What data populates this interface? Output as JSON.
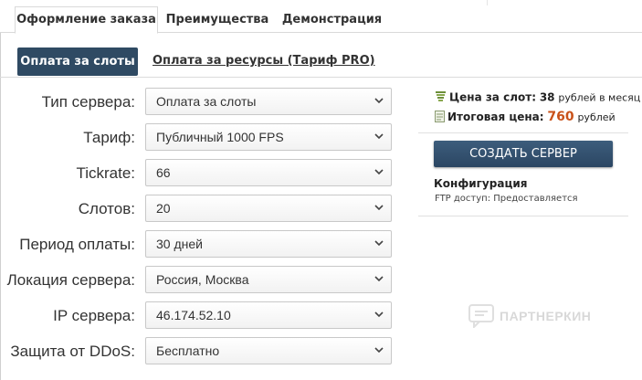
{
  "tabs": [
    {
      "label": "Оформление заказа",
      "active": true
    },
    {
      "label": "Преимущества",
      "active": false
    },
    {
      "label": "Демонстрация",
      "active": false
    }
  ],
  "payment": {
    "active_label": "Оплата за слоты",
    "alt_label": "Оплата за ресурсы (Тариф PRO)"
  },
  "form": {
    "rows": [
      {
        "label": "Тип сервера:",
        "value": "Оплата за слоты"
      },
      {
        "label": "Тариф:",
        "value": "Публичный 1000 FPS"
      },
      {
        "label": "Tickrate:",
        "value": "66"
      },
      {
        "label": "Слотов:",
        "value": "20"
      },
      {
        "label": "Период оплаты:",
        "value": "30 дней"
      },
      {
        "label": "Локация сервера:",
        "value": "Россия, Москва"
      },
      {
        "label": "IP сервера:",
        "value": "46.174.52.10"
      },
      {
        "label": "Защита от DDoS:",
        "value": "Бесплатно"
      }
    ]
  },
  "summary": {
    "slot_price_label": "Цена за слот:",
    "slot_price_value": "38",
    "slot_price_unit": "рублей в месяц",
    "total_label": "Итоговая цена:",
    "total_value": "760",
    "total_unit": "рублей",
    "create_button": "СОЗДАТЬ СЕРВЕР",
    "config_title": "Конфигурация",
    "ftp_text": "FTP доступ: Предоставляется"
  },
  "watermark": "ПАРТНЕРКИН",
  "colors": {
    "accent": "#2f4a63",
    "price": "#c9521a"
  }
}
